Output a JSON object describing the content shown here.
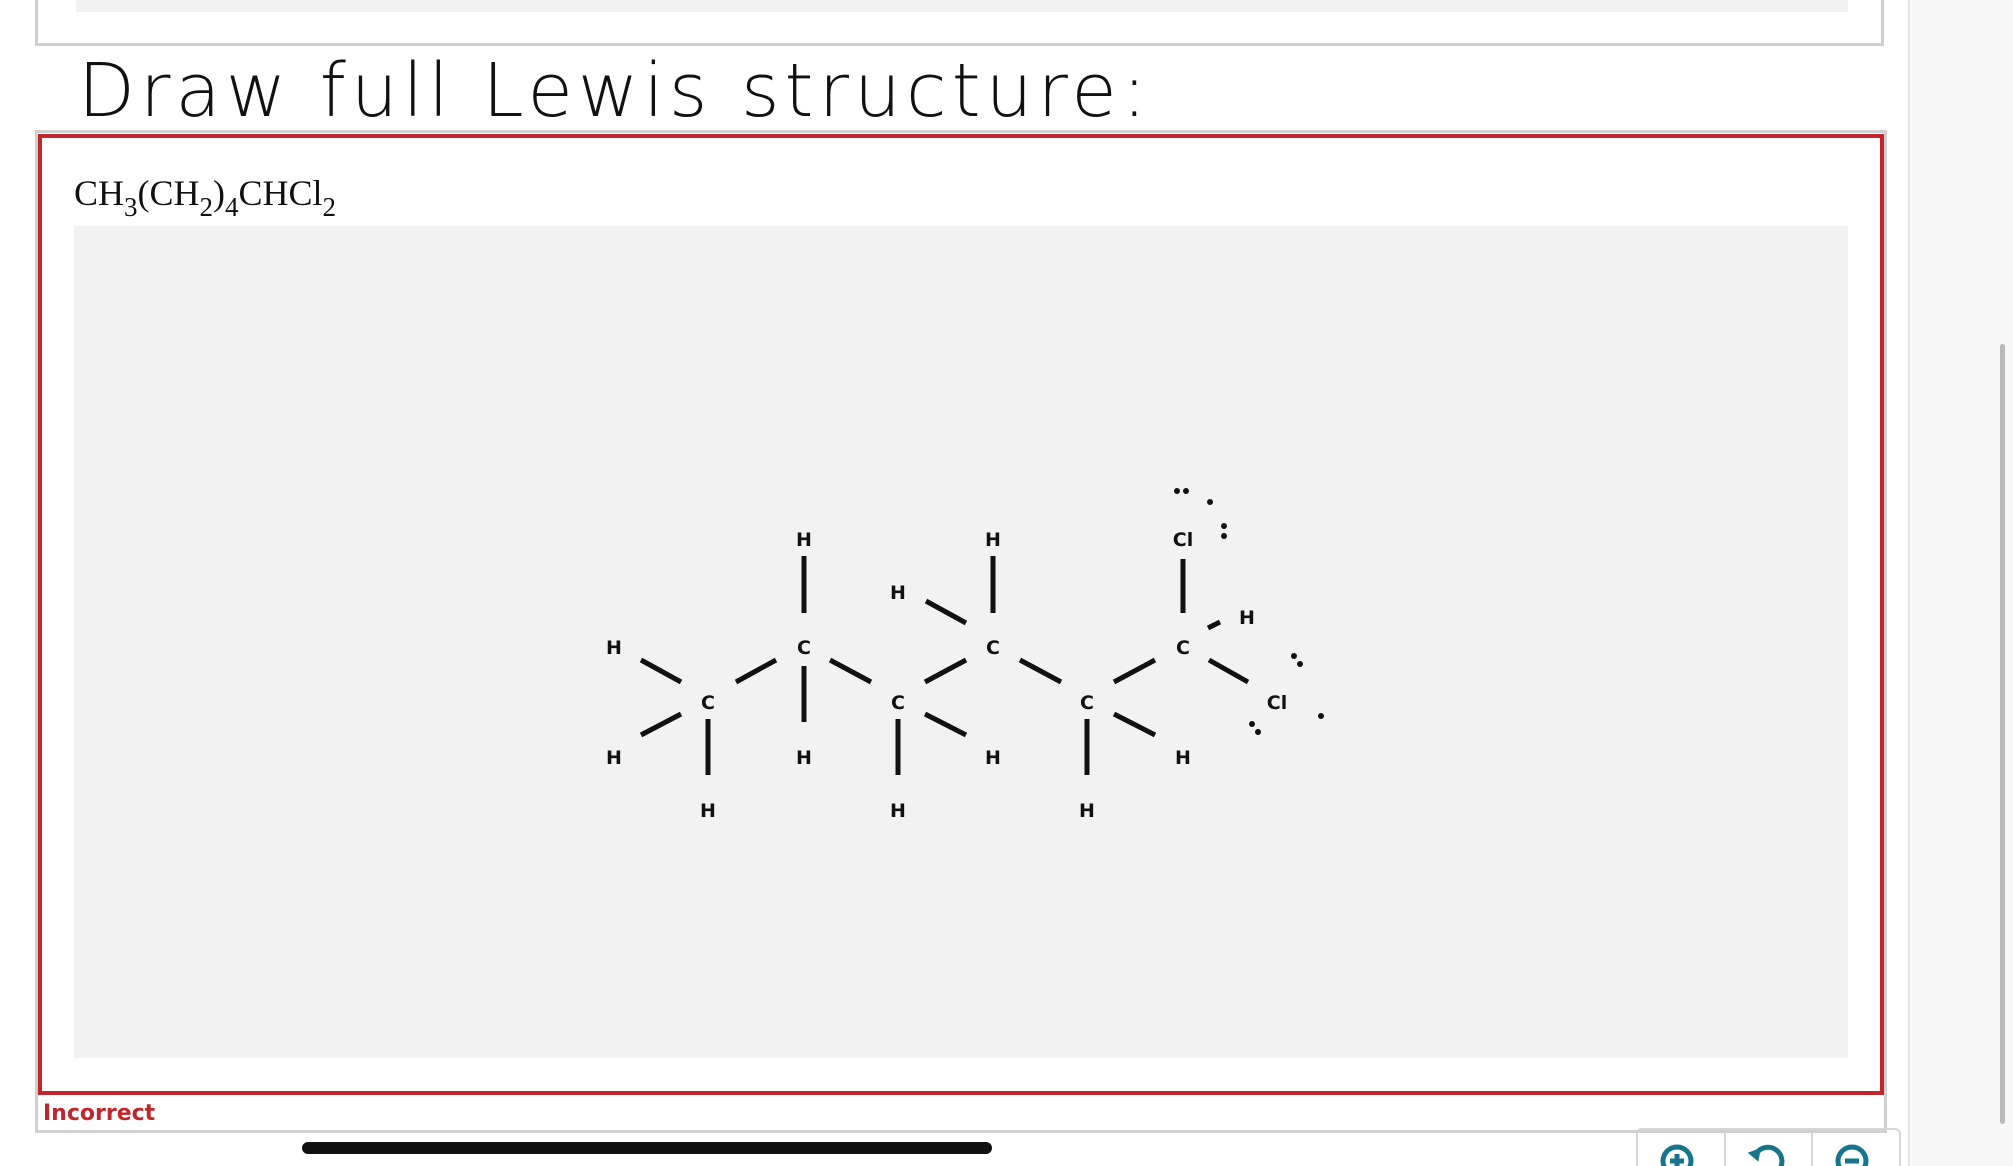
{
  "heading": "Draw full Lewis structure:",
  "formula": {
    "parts": [
      "CH",
      "3",
      "(CH",
      "2",
      ")",
      "4",
      "CHCl",
      "2"
    ]
  },
  "molecule_atoms": {
    "carbon": "C",
    "hydrogen": "H",
    "chlorine": "Cl"
  },
  "zoom_controls": {
    "zoom_in_icon": "zoom-in-icon",
    "reset_icon": "reset-zoom-icon",
    "zoom_out_icon": "zoom-out-icon"
  },
  "status": "Incorrect",
  "colors": {
    "error": "#c0262d",
    "icon": "#16758a",
    "canvas": "#f2f2f2"
  }
}
